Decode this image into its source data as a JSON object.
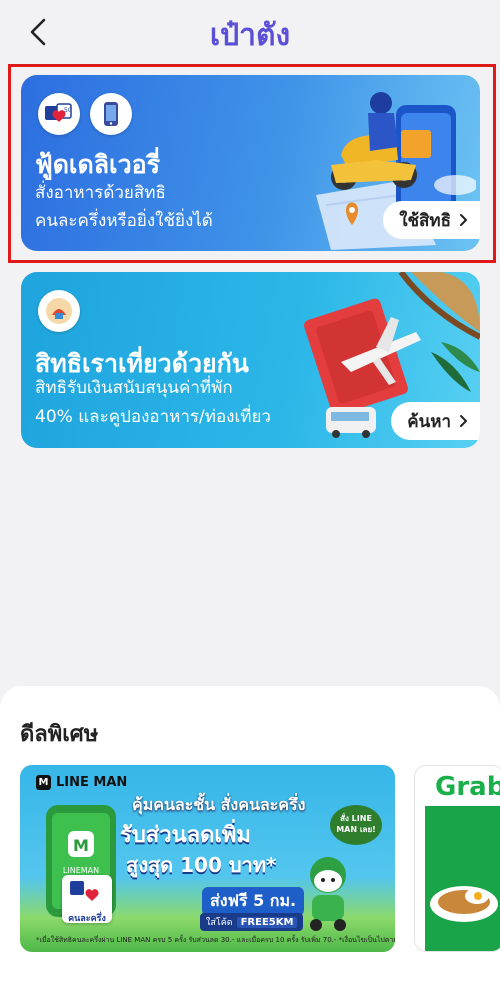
{
  "header": {
    "title": "เป๋าตัง",
    "back_icon": "chevron-left-icon"
  },
  "cards": [
    {
      "title": "ฟู้ดเดลิเวอรี่",
      "desc_line1": "สั่งอาหารด้วยสิทธิ",
      "desc_line2": "คนละครึ่งหรือยิ่งใช้ยิ่งได้",
      "button_label": "ใช้สิทธิ",
      "highlighted": true,
      "illustration": "delivery-scooter-phone-map"
    },
    {
      "title": "สิทธิเราเที่ยวด้วยกัน",
      "desc_line1": "สิทธิรับเงินสนับสนุนค่าที่พัก",
      "desc_line2": "40% และคูปองอาหาร/ท่องเที่ยว",
      "button_label": "ค้นหา",
      "illustration": "passport-airplane-hat-van"
    }
  ],
  "deals": {
    "title": "ดีลพิเศษ",
    "promos": [
      {
        "brand": "LINE MAN",
        "headline1": "คุ้มคนละชั้น สั่งคนละครึ่ง",
        "headline2": "รับส่วนลดเพิ่ม",
        "headline3": "สูงสุด 100 บาท*",
        "free_ship": "ส่งฟรี 5 กม.",
        "code_label": "ใส่โค้ด",
        "code": "FREE5KM",
        "cta_bubble": "สั่ง LINE MAN เลย!",
        "half_badge": "คนละครึ่ง",
        "fine_print": "*เมื่อใช้สิทธิคนละครึ่งผ่าน LINE MAN ครบ 5 ครั้ง รับส่วนลด 30.- และเมื่อครบ 10 ครั้ง รับเพิ่ม 70.- *เงื่อนไขเป็นไปตามที่บริษัท กำหนด"
      },
      {
        "brand": "Grab"
      }
    ]
  },
  "colors": {
    "title": "#5a4fd6",
    "highlight_border": "#e01919",
    "card1": "#2d6ee0",
    "card2": "#1fa4dd"
  }
}
